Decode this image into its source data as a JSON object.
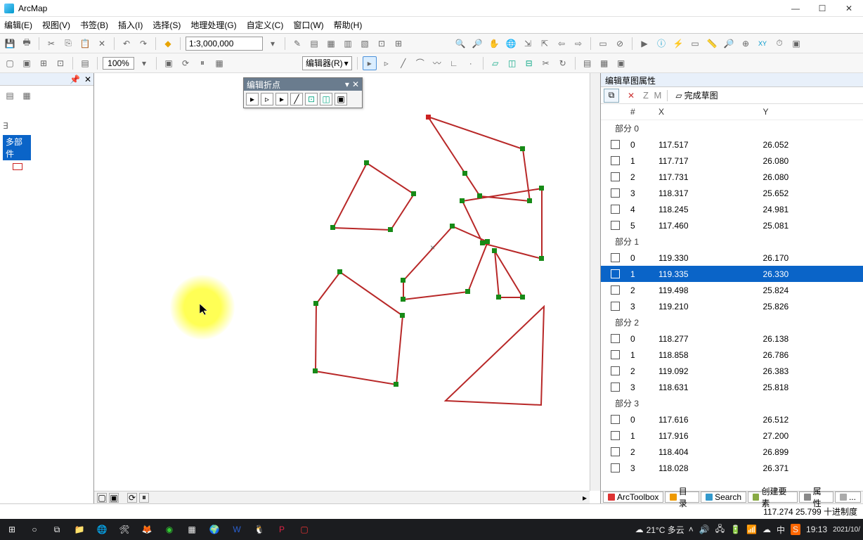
{
  "app": {
    "title": "ArcMap"
  },
  "menus": [
    "编辑(E)",
    "视图(V)",
    "书签(B)",
    "插入(I)",
    "选择(S)",
    "地理处理(G)",
    "自定义(C)",
    "窗口(W)",
    "帮助(H)"
  ],
  "toolbar": {
    "scale": "1:3,000,000",
    "zoom": "100%",
    "editor_label": "编辑器(R)"
  },
  "float_toolbar": {
    "title": "编辑折点"
  },
  "toc": {
    "selected_item": "多部件"
  },
  "props_panel": {
    "title": "编辑草图属性",
    "zm_label": "Z M",
    "done_label": "完成草图",
    "columns": {
      "idx": "#",
      "x": "X",
      "y": "Y"
    },
    "part_prefix": "部分"
  },
  "chart_data": {
    "type": "table",
    "parts": [
      {
        "id": 0,
        "vertices": [
          {
            "i": 0,
            "x": "117.517",
            "y": "26.052"
          },
          {
            "i": 1,
            "x": "117.717",
            "y": "26.080"
          },
          {
            "i": 2,
            "x": "117.731",
            "y": "26.080"
          },
          {
            "i": 3,
            "x": "118.317",
            "y": "25.652"
          },
          {
            "i": 4,
            "x": "118.245",
            "y": "24.981"
          },
          {
            "i": 5,
            "x": "117.460",
            "y": "25.081"
          }
        ]
      },
      {
        "id": 1,
        "selected_row": 1,
        "vertices": [
          {
            "i": 0,
            "x": "119.330",
            "y": "26.170"
          },
          {
            "i": 1,
            "x": "119.335",
            "y": "26.330"
          },
          {
            "i": 2,
            "x": "119.498",
            "y": "25.824"
          },
          {
            "i": 3,
            "x": "119.210",
            "y": "25.826"
          }
        ]
      },
      {
        "id": 2,
        "vertices": [
          {
            "i": 0,
            "x": "118.277",
            "y": "26.138"
          },
          {
            "i": 1,
            "x": "118.858",
            "y": "26.786"
          },
          {
            "i": 2,
            "x": "119.092",
            "y": "26.383"
          },
          {
            "i": 3,
            "x": "118.631",
            "y": "25.818"
          }
        ]
      },
      {
        "id": 3,
        "vertices": [
          {
            "i": 0,
            "x": "117.616",
            "y": "26.512"
          },
          {
            "i": 1,
            "x": "117.916",
            "y": "27.200"
          },
          {
            "i": 2,
            "x": "118.404",
            "y": "26.899"
          },
          {
            "i": 3,
            "x": "118.028",
            "y": "26.371"
          }
        ]
      }
    ]
  },
  "statusbar": {
    "coords": "117.274  25.799 十进制度"
  },
  "bottom_tabs": [
    "ArcToolbox",
    "目录",
    "Search",
    "创建要素",
    "属性"
  ],
  "taskbar": {
    "weather_temp": "21°C 多云",
    "time": "19:13",
    "date": "2021/10/"
  }
}
